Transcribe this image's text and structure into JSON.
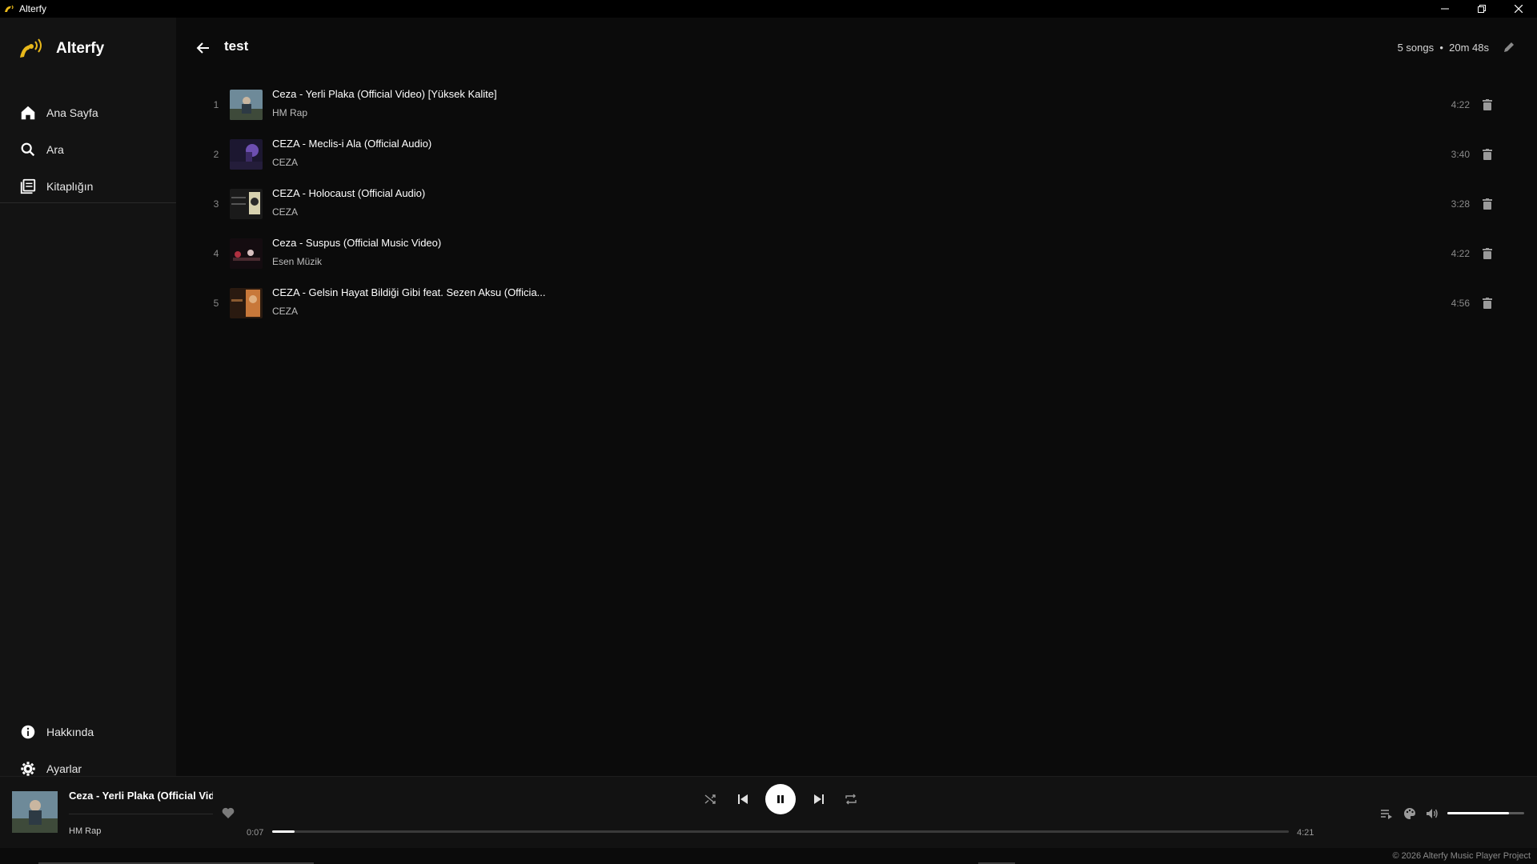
{
  "window": {
    "title": "Alterfy",
    "icon": "bird-logo-icon",
    "buttons": [
      "minimize-icon",
      "restore-icon",
      "close-icon"
    ]
  },
  "sidebar": {
    "brand": "Alterfy",
    "accent": "#e8b81b",
    "items": [
      {
        "label": "Ana Sayfa",
        "icon": "home-icon"
      },
      {
        "label": "Ara",
        "icon": "search-icon"
      },
      {
        "label": "Kitaplığın",
        "icon": "library-icon"
      }
    ],
    "bottom_items": [
      {
        "label": "Hakkında",
        "icon": "info-icon"
      },
      {
        "label": "Ayarlar",
        "icon": "gear-icon"
      }
    ]
  },
  "playlist": {
    "title": "test",
    "meta": "5 songs  •  20m 48s",
    "tracks": [
      {
        "num": "1",
        "title": "Ceza - Yerli Plaka (Official Video) [Yüksek Kalite]",
        "artist": "HM Rap",
        "duration": "4:22"
      },
      {
        "num": "2",
        "title": "CEZA - Meclis-i Ala (Official Audio)",
        "artist": "CEZA",
        "duration": "3:40"
      },
      {
        "num": "3",
        "title": "CEZA - Holocaust (Official Audio)",
        "artist": "CEZA",
        "duration": "3:28"
      },
      {
        "num": "4",
        "title": "Ceza - Suspus (Official Music Video)",
        "artist": "Esen Müzik",
        "duration": "4:22"
      },
      {
        "num": "5",
        "title": "CEZA - Gelsin Hayat Bildiği Gibi feat. Sezen Aksu (Officia...",
        "artist": "CEZA",
        "duration": "4:56"
      }
    ]
  },
  "player": {
    "title": "Ceza - Yerli Plaka (Official Video) [Yüksek Kalite]",
    "artist": "HM Rap",
    "current_time": "0:07",
    "total_time": "4:21",
    "progress": 0.022,
    "volume": 0.8,
    "state": "playing"
  },
  "footer": {
    "copyright": "© 2026 Alterfy Music Player Project"
  }
}
